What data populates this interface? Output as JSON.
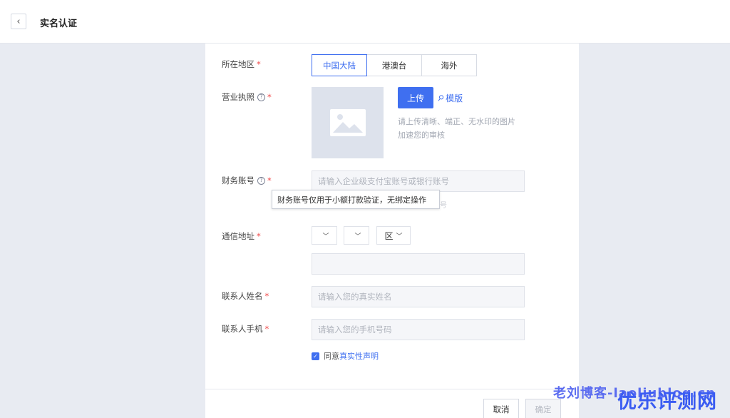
{
  "header": {
    "back_icon": "chevron-left-icon",
    "title": "实名认证"
  },
  "form": {
    "region": {
      "label": "所在地区",
      "required_mark": "*",
      "options": [
        "中国大陆",
        "港澳台",
        "海外"
      ],
      "selected": "中国大陆"
    },
    "license": {
      "label": "营业执照",
      "help_icon": "question-circle-icon",
      "help_glyph": "?",
      "required_mark": "*",
      "placeholder_icon": "image-placeholder-icon",
      "upload_label": "上传",
      "template_icon": "paperclip-icon",
      "template_label": "模版",
      "hint_line1": "请上传清晰、端正、无水印的图片",
      "hint_line2": "加速您的审核"
    },
    "account": {
      "label": "财务账号",
      "help_icon": "question-circle-icon",
      "help_glyph": "?",
      "required_mark": "*",
      "placeholder": "请输入企业级支付宝账号或银行账号",
      "tooltip": "财务账号仅用于小额打款验证，无绑定操作",
      "tooltip_tail": "号"
    },
    "address": {
      "label": "通信地址",
      "required_mark": "*",
      "province_value": "",
      "city_value": "",
      "district_value": "区",
      "chevron_icon": "chevron-down-icon",
      "detail_value": ""
    },
    "contact_name": {
      "label": "联系人姓名",
      "required_mark": "*",
      "placeholder": "请输入您的真实姓名"
    },
    "contact_phone": {
      "label": "联系人手机",
      "required_mark": "*",
      "placeholder": "请输入您的手机号码"
    },
    "agreement": {
      "checked": true,
      "check_glyph": "✓",
      "prefix": "同意",
      "link": "真实性声明"
    }
  },
  "footer": {
    "cancel_label": "取消",
    "confirm_label": "确定"
  },
  "watermark": {
    "line1": "老刘博客-laoliublog.cn",
    "line2": "优乐评测网"
  },
  "colors": {
    "accent": "#3f6ff0",
    "required": "#f04848",
    "page_bg": "#e8ebf2"
  }
}
